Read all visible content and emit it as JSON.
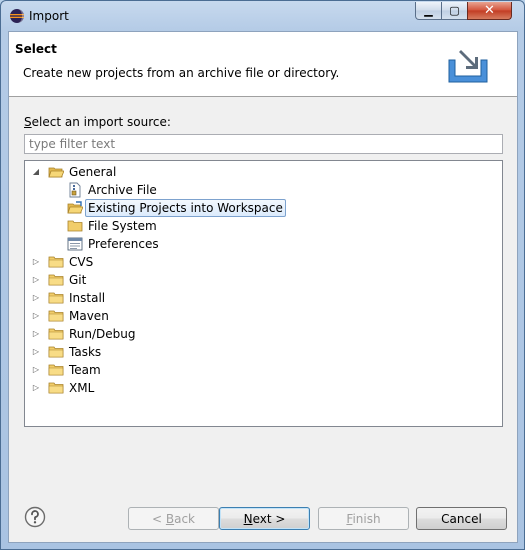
{
  "window": {
    "title": "Import"
  },
  "window_controls": {
    "minimize": "▁",
    "maximize": "▢",
    "close": "✕"
  },
  "header": {
    "title": "Select",
    "description": "Create new projects from an archive file or directory.",
    "icon": "import-wizard-icon"
  },
  "source": {
    "label_accel": "S",
    "label_rest": "elect an import source:",
    "filter_placeholder": "type filter text"
  },
  "tree": {
    "general": {
      "label": "General",
      "expanded": true,
      "icon": "folder-open-icon"
    },
    "general_children": [
      {
        "label": "Archive File",
        "icon": "archive-file-icon",
        "selected": false
      },
      {
        "label": "Existing Projects into Workspace",
        "icon": "existing-projects-icon",
        "selected": true
      },
      {
        "label": "File System",
        "icon": "folder-icon",
        "selected": false
      },
      {
        "label": "Preferences",
        "icon": "preferences-icon",
        "selected": false
      }
    ],
    "categories": [
      {
        "label": "CVS"
      },
      {
        "label": "Git"
      },
      {
        "label": "Install"
      },
      {
        "label": "Maven"
      },
      {
        "label": "Run/Debug"
      },
      {
        "label": "Tasks"
      },
      {
        "label": "Team"
      },
      {
        "label": "XML"
      }
    ]
  },
  "buttons": {
    "back": {
      "prefix": "< ",
      "accel": "B",
      "rest": "ack"
    },
    "next": {
      "accel": "N",
      "rest": "ext >"
    },
    "finish": {
      "accel": "F",
      "rest": "inish"
    },
    "cancel": {
      "label": "Cancel"
    }
  },
  "colors": {
    "selection_border": "#7da2ce",
    "folder": "#e8c35a",
    "title_bar": "#b4cbe6"
  }
}
